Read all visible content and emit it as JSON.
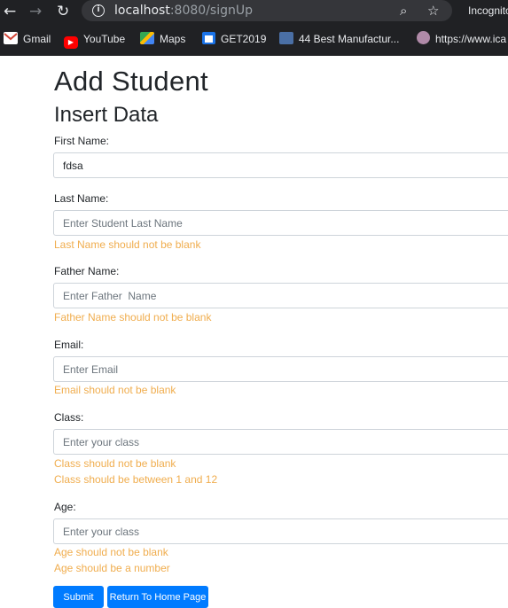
{
  "browser": {
    "url_host": "localhost",
    "url_path": ":8080/signUp",
    "incognito_label": "Incognito",
    "bookmarks": [
      {
        "label": "Gmail",
        "icon": "gmail-icon",
        "color": "#d44638"
      },
      {
        "label": "YouTube",
        "icon": "youtube-icon",
        "color": "#ff0000"
      },
      {
        "label": "Maps",
        "icon": "maps-icon",
        "color": "#34a853"
      },
      {
        "label": "GET2019",
        "icon": "calendar-icon",
        "color": "#1a73e8"
      },
      {
        "label": "44 Best Manufactur...",
        "icon": "site-icon",
        "color": "#4a6fa5"
      },
      {
        "label": "https://www.ica",
        "icon": "globe-icon",
        "color": "#b08aa8"
      }
    ]
  },
  "page": {
    "title": "Add Student",
    "subtitle": "Insert Data"
  },
  "form": {
    "first_name": {
      "label": "First Name:",
      "value": "fdsa",
      "placeholder": ""
    },
    "last_name": {
      "label": "Last Name:",
      "value": "",
      "placeholder": "Enter Student Last Name",
      "errors": [
        "Last Name should not be blank"
      ]
    },
    "father_name": {
      "label": "Father Name:",
      "value": "",
      "placeholder": "Enter Father  Name",
      "errors": [
        "Father Name should not be blank"
      ]
    },
    "email": {
      "label": "Email:",
      "value": "",
      "placeholder": "Enter Email",
      "errors": [
        "Email should not be blank"
      ]
    },
    "class": {
      "label": "Class:",
      "value": "",
      "placeholder": "Enter your class",
      "errors": [
        "Class should not be blank",
        "Class should be between 1 and 12"
      ]
    },
    "age": {
      "label": "Age:",
      "value": "",
      "placeholder": "Enter your class",
      "errors": [
        "Age should not be blank",
        "Age should be a number"
      ]
    },
    "submit_label": "Submit",
    "home_label": "Return To Home Page"
  },
  "colors": {
    "error": "#f0ad4e",
    "primary": "#007bff"
  }
}
